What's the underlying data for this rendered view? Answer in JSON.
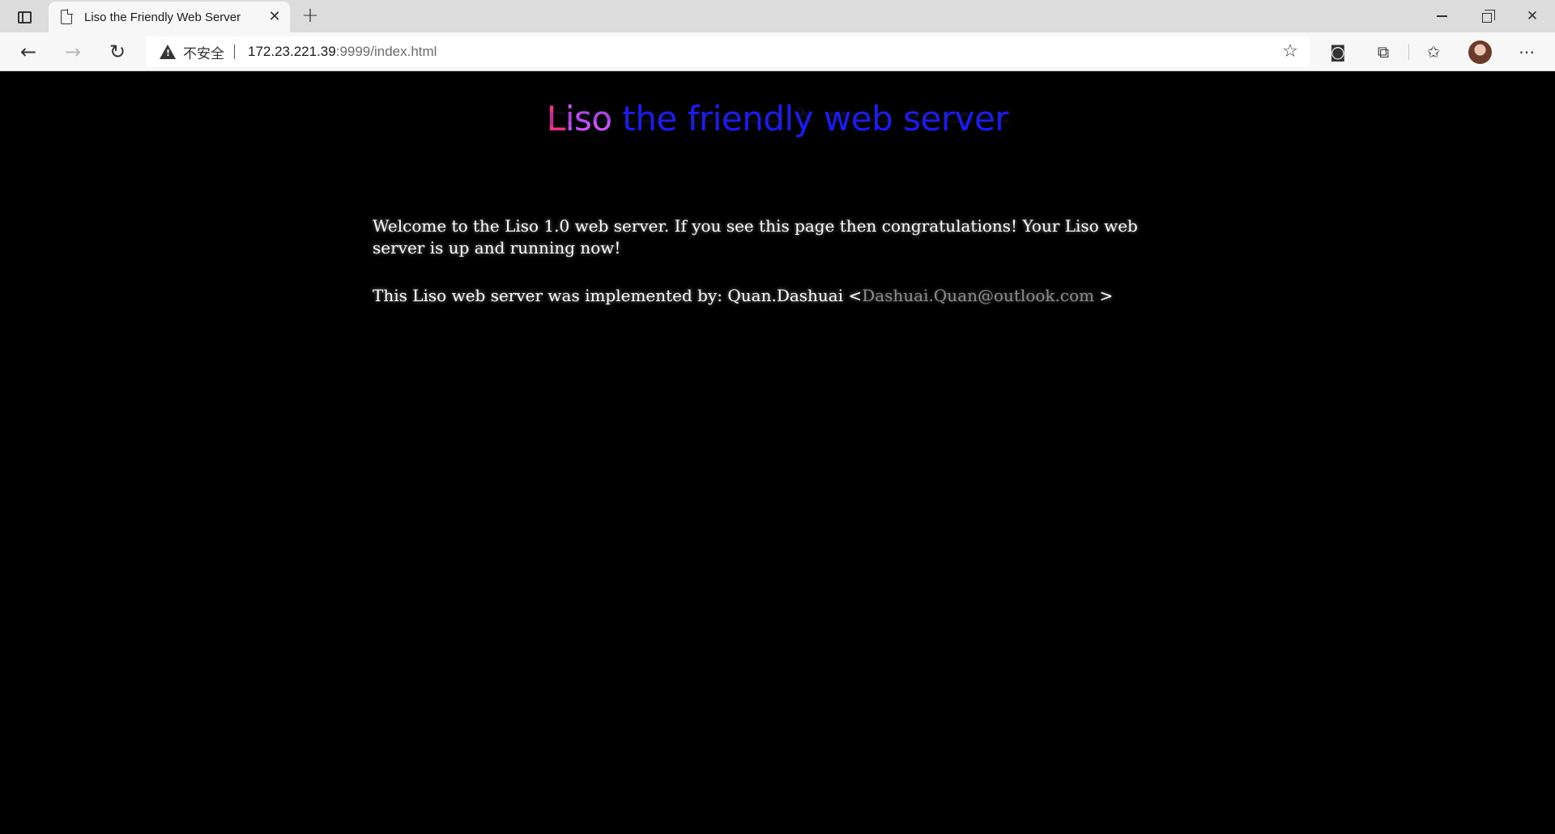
{
  "browser": {
    "tab": {
      "title": "Liso the Friendly Web Server"
    },
    "address": {
      "security_label": "不安全",
      "url_host": "172.23.221.39",
      "url_rest": ":9999/index.html"
    }
  },
  "page": {
    "logo": {
      "first": "L",
      "second": "iso",
      "rest": " the friendly web server"
    },
    "welcome_text": "Welcome to the Liso 1.0 web server. If you see this page then congratulations! Your Liso web server is up and running now!",
    "implemented_by_prefix": "This Liso web server was implemented by: Quan.Dashuai <",
    "email": "Dashuai.Quan@outlook.com",
    "implemented_by_suffix": " >"
  },
  "icons": {
    "tab_actions": "tab-actions-icon",
    "page": "page-icon",
    "close": "close-icon",
    "new_tab": "plus-icon",
    "back": "back-arrow-icon",
    "forward": "forward-arrow-icon",
    "refresh": "refresh-icon",
    "warning": "warning-icon",
    "favorite_add": "star-add-icon",
    "collections": "collections-icon",
    "extensions": "puzzle-icon",
    "favorites": "favorites-icon",
    "profile": "avatar",
    "more": "more-icon"
  },
  "colors": {
    "logo_l": "#ff2d87",
    "logo_iso": "#d050ff",
    "logo_rest": "#1a1aff",
    "page_bg": "#000000",
    "email": "#8c8c8c"
  }
}
